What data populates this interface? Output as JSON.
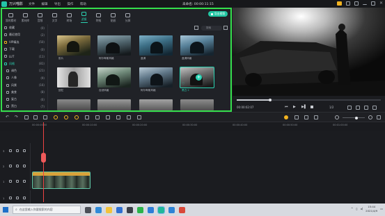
{
  "titlebar": {
    "app_name": "万兴喵影",
    "menu": [
      "文件",
      "编辑",
      "导出",
      "操作",
      "帮助"
    ],
    "project": "未命名: 00:00:11:15"
  },
  "tabs": [
    {
      "label": "我的素材",
      "active": false
    },
    {
      "label": "素材库",
      "active": false
    },
    {
      "label": "音频",
      "active": false
    },
    {
      "label": "文字",
      "active": false
    },
    {
      "label": "转场",
      "active": false
    },
    {
      "label": "滤镜",
      "active": true
    },
    {
      "label": "特效",
      "active": false
    },
    {
      "label": "贴纸",
      "active": false
    },
    {
      "label": "分屏",
      "active": false
    }
  ],
  "export_label": "导出视频",
  "sidebar": [
    {
      "label": "收藏",
      "count": "(0)",
      "icon": "heart-icon",
      "selected": false
    },
    {
      "label": "最近使用",
      "count": "(2)",
      "icon": "clock-icon",
      "selected": false
    },
    {
      "label": "VIP精选",
      "count": "(50)",
      "icon": "vip-icon",
      "selected": false
    },
    {
      "label": "下载",
      "count": "(0)",
      "icon": "download-icon",
      "selected": false
    },
    {
      "label": "LUT",
      "count": "(11)",
      "icon": "folder-icon",
      "selected": false
    },
    {
      "label": "风格",
      "count": "(81)",
      "icon": "folder-icon",
      "selected": true
    },
    {
      "label": "调色",
      "count": "(21)",
      "icon": "folder-icon",
      "selected": false
    },
    {
      "label": "人像",
      "count": "(9)",
      "icon": "folder-icon",
      "selected": false
    },
    {
      "label": "风景",
      "count": "(16)",
      "icon": "folder-icon",
      "selected": false
    },
    {
      "label": "美食",
      "count": "(8)",
      "icon": "folder-icon",
      "selected": false
    },
    {
      "label": "复古",
      "count": "(6)",
      "icon": "folder-icon",
      "selected": false
    },
    {
      "label": "黑白",
      "count": "(7)",
      "icon": "folder-icon",
      "selected": false
    }
  ],
  "search_placeholder": "搜索",
  "filters": [
    {
      "label": "胶片",
      "selected": false
    },
    {
      "label": "阿尔卑斯风格",
      "selected": false
    },
    {
      "label": "蓝调",
      "selected": false
    },
    {
      "label": "蓝调风格",
      "selected": false
    },
    {
      "label": "回忆",
      "selected": false
    },
    {
      "label": "自然风格",
      "selected": false
    },
    {
      "label": "阿尔卑斯风格",
      "selected": false
    },
    {
      "label": "黑白 2",
      "selected": true
    },
    {
      "label": "",
      "selected": false
    },
    {
      "label": "",
      "selected": false
    },
    {
      "label": "",
      "selected": false
    },
    {
      "label": "",
      "selected": false
    }
  ],
  "preview": {
    "current_time": "00:00:02:07",
    "ratio": "1/2"
  },
  "timeline": {
    "ticks": [
      "00:00:00:00",
      "00:00:10:00",
      "00:00:20:00",
      "00:00:30:00",
      "00:00:40:00",
      "00:00:50:00",
      "00:01:00:00",
      "00:01:10:00",
      "00:01:20:00",
      "00:01:30:00",
      "00:01:40:00"
    ],
    "tracks": [
      "3",
      "2",
      "1",
      "1"
    ]
  },
  "taskbar": {
    "search_placeholder": "在这里输入你要搜索的内容",
    "time": "15:44",
    "date": "2021/4/9"
  }
}
